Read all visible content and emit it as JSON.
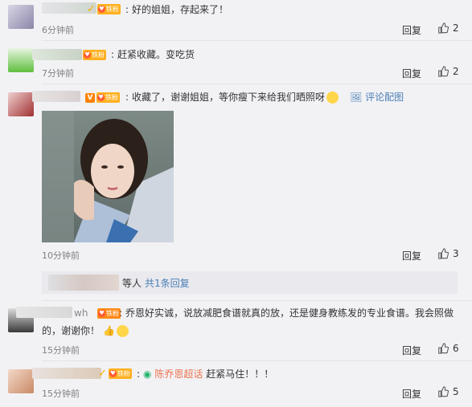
{
  "comments": [
    {
      "text": "好的姐姐，存起来了！",
      "time": "6分钟前",
      "reply": "回复",
      "likes": "2",
      "fan_badge": "铁粉"
    },
    {
      "text": "赶紧收藏。变吃货",
      "time": "7分钟前",
      "reply": "回复",
      "likes": "2",
      "fan_badge": "铁粉"
    },
    {
      "text": "收藏了，谢谢姐姐，等你瘦下来给我们晒照呀",
      "emoji": "smile-emoji",
      "pic_link": "评论配图",
      "time": "10分钟前",
      "reply": "回复",
      "likes": "3",
      "fan_badge": "铁粉",
      "vip": "V"
    },
    {
      "text_line1": "乔恩好实诚，说放减肥食谱就真的放，还是健身教练发的专业食谱。我会照做",
      "text_line2": "的，谢谢你！",
      "name_suffix": "wh",
      "time": "15分钟前",
      "reply": "回复",
      "likes": "6",
      "fan_badge": "铁粉"
    },
    {
      "topic": "陈乔恩超话",
      "text": "赶紧马住！！！",
      "time": "15分钟前",
      "reply": "回复",
      "likes": "5",
      "fan_badge": "铁粉"
    }
  ],
  "subreply": {
    "suffix": "等人",
    "link": "共1条回复"
  },
  "colors": {
    "background": "#f2f2f5",
    "link_blue": "#4a7fb5",
    "fan_badge": "#ffb020",
    "vip_orange": "#ff8200"
  }
}
